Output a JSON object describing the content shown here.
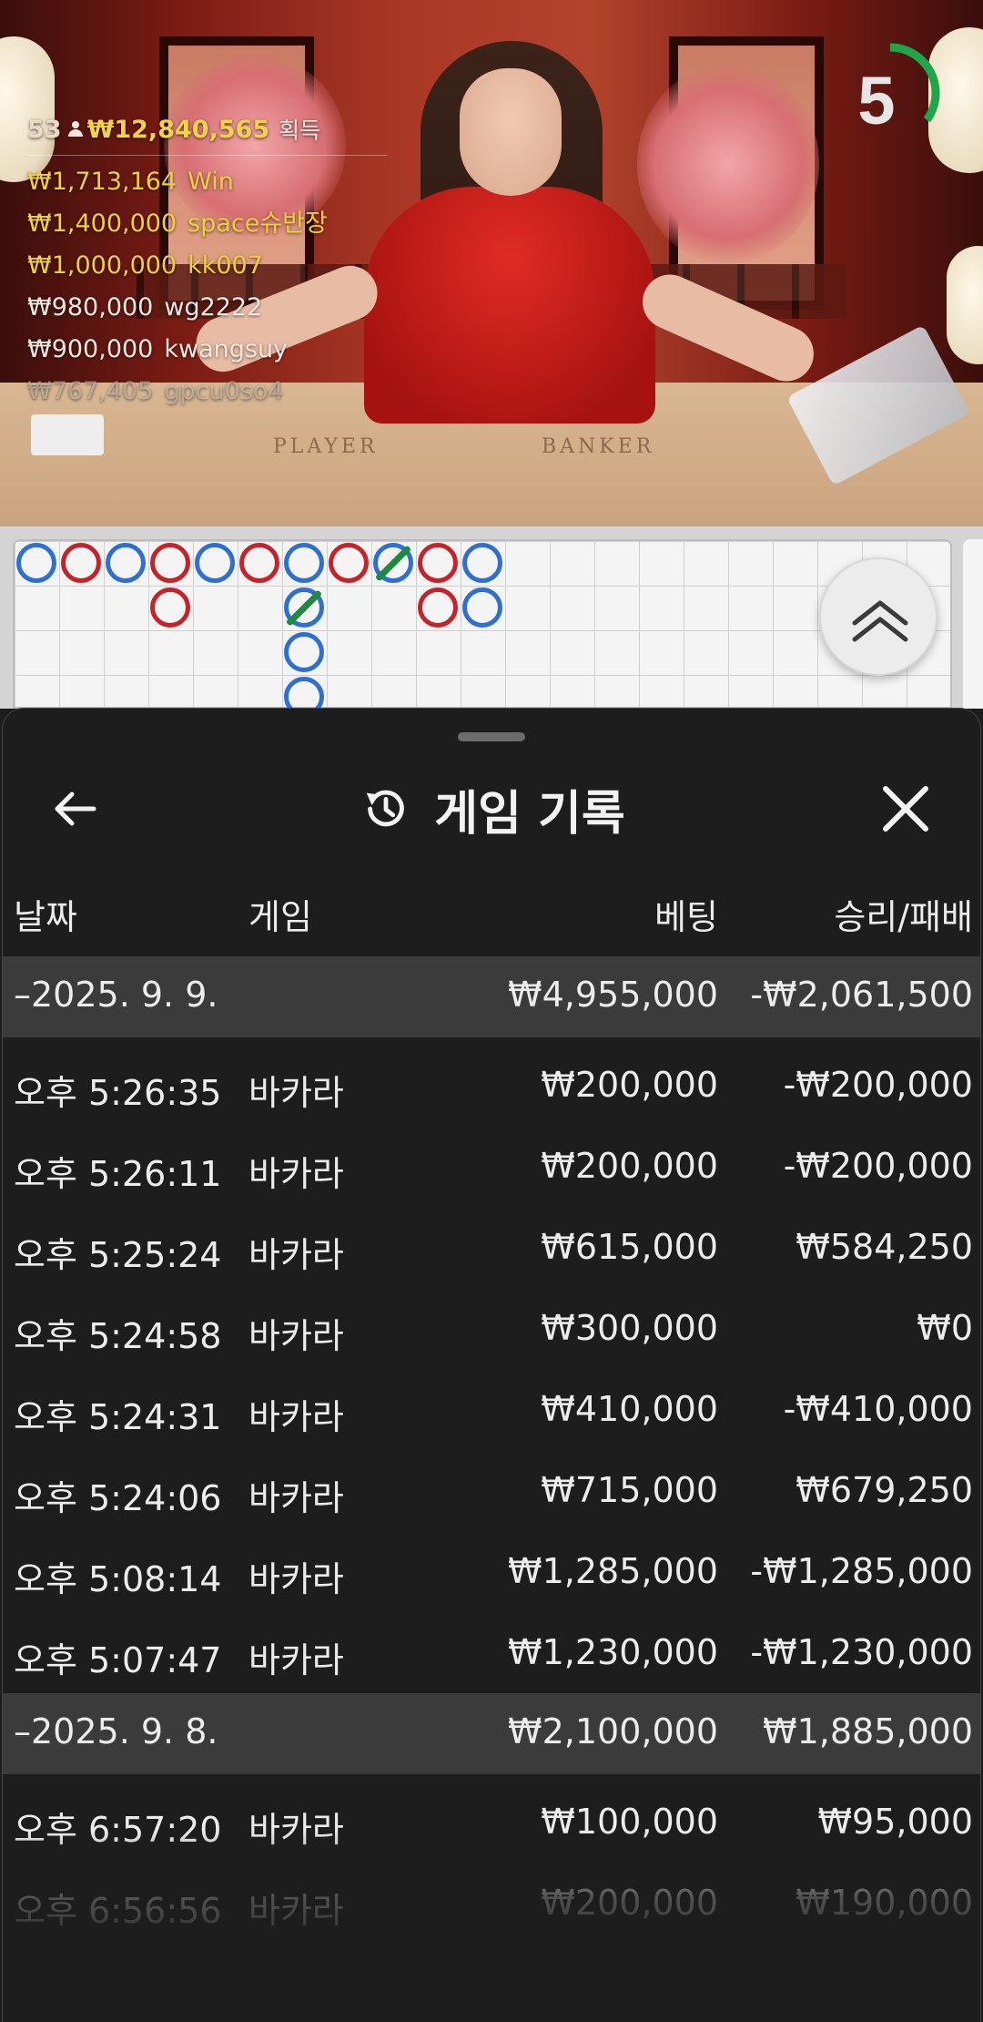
{
  "live": {
    "winners_summary": {
      "count": "53",
      "total": "₩12,840,565",
      "won_label": "획득"
    },
    "winners": [
      {
        "amount": "₩1,713,164",
        "name": "Win",
        "tone": "gold"
      },
      {
        "amount": "₩1,400,000",
        "name": "space슈반장",
        "tone": "gold"
      },
      {
        "amount": "₩1,000,000",
        "name": "kk007",
        "tone": "gold"
      },
      {
        "amount": "₩980,000",
        "name": "wg2222",
        "tone": "white"
      },
      {
        "amount": "₩900,000",
        "name": "kwangsuy",
        "tone": "white"
      },
      {
        "amount": "₩767,405",
        "name": "gpcu0so4",
        "tone": "fade"
      }
    ],
    "table_labels": {
      "player": "PLAYER",
      "banker": "BANKER"
    },
    "countdown": "5",
    "colors": {
      "player_blue": "#2f6fd0",
      "banker_red": "#c4232a",
      "tie_green": "#1c8a3f",
      "timer_green": "#1fa64a"
    }
  },
  "roadmap": {
    "beads": [
      {
        "col": 0,
        "row": 0,
        "result": "blue"
      },
      {
        "col": 1,
        "row": 0,
        "result": "red"
      },
      {
        "col": 2,
        "row": 0,
        "result": "blue"
      },
      {
        "col": 3,
        "row": 0,
        "result": "red"
      },
      {
        "col": 3,
        "row": 1,
        "result": "red"
      },
      {
        "col": 4,
        "row": 0,
        "result": "blue"
      },
      {
        "col": 5,
        "row": 0,
        "result": "red"
      },
      {
        "col": 6,
        "row": 0,
        "result": "blue"
      },
      {
        "col": 6,
        "row": 1,
        "result": "blue",
        "tie": true
      },
      {
        "col": 6,
        "row": 2,
        "result": "blue"
      },
      {
        "col": 6,
        "row": 3,
        "result": "blue"
      },
      {
        "col": 7,
        "row": 0,
        "result": "red"
      },
      {
        "col": 8,
        "row": 0,
        "result": "blue",
        "tie": true
      },
      {
        "col": 9,
        "row": 0,
        "result": "red"
      },
      {
        "col": 9,
        "row": 1,
        "result": "red"
      },
      {
        "col": 10,
        "row": 0,
        "result": "blue"
      },
      {
        "col": 10,
        "row": 1,
        "result": "blue"
      }
    ],
    "collapse_icon": "double-chevron-up-icon"
  },
  "history": {
    "title": "게임 기록",
    "back_icon": "arrow-left-icon",
    "title_icon": "history-icon",
    "close_icon": "close-icon",
    "columns": {
      "date": "날짜",
      "game": "게임",
      "bet": "베팅",
      "result": "승리/패배"
    },
    "rows": [
      {
        "type": "group",
        "date": "–2025. 9. 9.",
        "game": "",
        "bet": "₩4,955,000",
        "result": "-₩2,061,500"
      },
      {
        "type": "item",
        "date": "오후 5:26:35",
        "game": "바카라",
        "bet": "₩200,000",
        "result": "-₩200,000"
      },
      {
        "type": "item",
        "date": "오후 5:26:11",
        "game": "바카라",
        "bet": "₩200,000",
        "result": "-₩200,000"
      },
      {
        "type": "item",
        "date": "오후 5:25:24",
        "game": "바카라",
        "bet": "₩615,000",
        "result": "₩584,250"
      },
      {
        "type": "item",
        "date": "오후 5:24:58",
        "game": "바카라",
        "bet": "₩300,000",
        "result": "₩0"
      },
      {
        "type": "item",
        "date": "오후 5:24:31",
        "game": "바카라",
        "bet": "₩410,000",
        "result": "-₩410,000"
      },
      {
        "type": "item",
        "date": "오후 5:24:06",
        "game": "바카라",
        "bet": "₩715,000",
        "result": "₩679,250"
      },
      {
        "type": "item",
        "date": "오후 5:08:14",
        "game": "바카라",
        "bet": "₩1,285,000",
        "result": "-₩1,285,000"
      },
      {
        "type": "item",
        "date": "오후 5:07:47",
        "game": "바카라",
        "bet": "₩1,230,000",
        "result": "-₩1,230,000"
      },
      {
        "type": "group",
        "date": "–2025. 9. 8.",
        "game": "",
        "bet": "₩2,100,000",
        "result": "₩1,885,000"
      },
      {
        "type": "item",
        "date": "오후 6:57:20",
        "game": "바카라",
        "bet": "₩100,000",
        "result": "₩95,000"
      },
      {
        "type": "item",
        "date": "오후 6:56:56",
        "game": "바카라",
        "bet": "₩200,000",
        "result": "₩190,000"
      }
    ]
  }
}
